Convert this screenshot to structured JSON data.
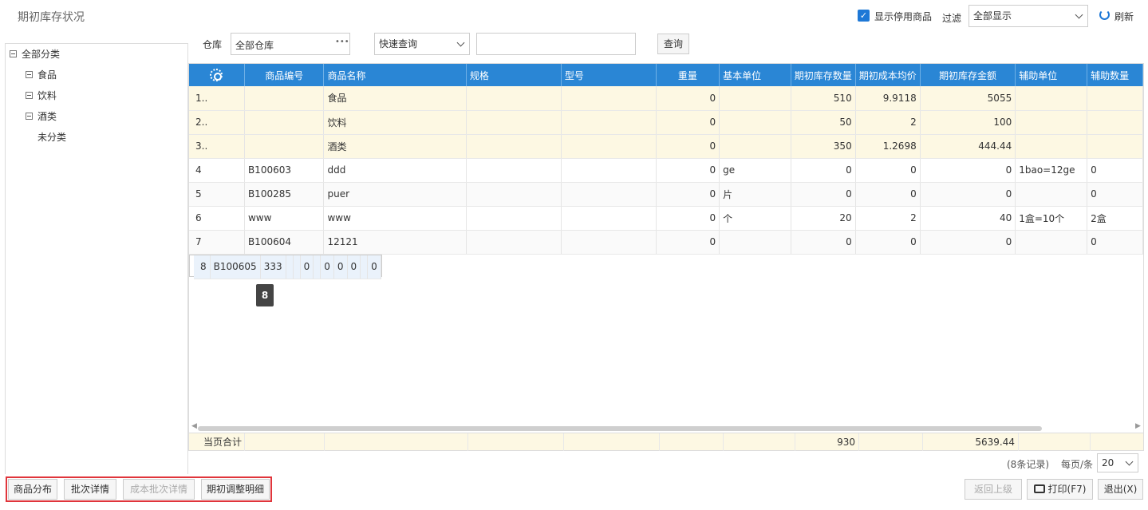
{
  "page_title": "期初库存状况",
  "top_bar": {
    "show_disabled_label": "显示停用商品",
    "show_disabled_checked": true,
    "filter_label": "过滤",
    "filter_value": "全部显示",
    "refresh_label": "刷新"
  },
  "filter_bar": {
    "warehouse_label": "仓库",
    "warehouse_value": "全部仓库",
    "ellipsis": "•••",
    "quick_query_value": "快速查询",
    "search_value": "",
    "query_button": "查询"
  },
  "tree": {
    "root": "全部分类",
    "items": [
      "食品",
      "饮料",
      "酒类",
      "未分类"
    ]
  },
  "table": {
    "columns": [
      "商品编号",
      "商品名称",
      "规格",
      "型号",
      "重量",
      "基本单位",
      "期初库存数量",
      "期初成本均价",
      "期初库存金额",
      "辅助单位",
      "辅助数量"
    ],
    "rows": [
      {
        "no": "1..",
        "code": "",
        "name": "食品",
        "spec": "",
        "model": "",
        "weight": "0",
        "unit": "",
        "qty": "510",
        "price": "9.9118",
        "amount": "5055",
        "aux_unit": "",
        "aux_qty": ""
      },
      {
        "no": "2..",
        "code": "",
        "name": "饮料",
        "spec": "",
        "model": "",
        "weight": "0",
        "unit": "",
        "qty": "50",
        "price": "2",
        "amount": "100",
        "aux_unit": "",
        "aux_qty": ""
      },
      {
        "no": "3..",
        "code": "",
        "name": "酒类",
        "spec": "",
        "model": "",
        "weight": "0",
        "unit": "",
        "qty": "350",
        "price": "1.2698",
        "amount": "444.44",
        "aux_unit": "",
        "aux_qty": ""
      },
      {
        "no": "4",
        "code": "B100603",
        "name": "ddd",
        "spec": "",
        "model": "",
        "weight": "0",
        "unit": "ge",
        "qty": "0",
        "price": "0",
        "amount": "0",
        "aux_unit": "1bao=12ge",
        "aux_qty": "0"
      },
      {
        "no": "5",
        "code": "B100285",
        "name": "puer",
        "spec": "",
        "model": "",
        "weight": "0",
        "unit": "片",
        "qty": "0",
        "price": "0",
        "amount": "0",
        "aux_unit": "",
        "aux_qty": "0"
      },
      {
        "no": "6",
        "code": "www",
        "name": "www",
        "spec": "",
        "model": "",
        "weight": "0",
        "unit": "个",
        "qty": "20",
        "price": "2",
        "amount": "40",
        "aux_unit": "1盒=10个",
        "aux_qty": "2盒"
      },
      {
        "no": "7",
        "code": "B100604",
        "name": "12121",
        "spec": "",
        "model": "",
        "weight": "0",
        "unit": "",
        "qty": "0",
        "price": "0",
        "amount": "0",
        "aux_unit": "",
        "aux_qty": "0"
      },
      {
        "no": "8",
        "code": "B100605",
        "name": "333",
        "spec": "",
        "model": "",
        "weight": "0",
        "unit": "",
        "qty": "0",
        "price": "0",
        "amount": "0",
        "aux_unit": "",
        "aux_qty": "0"
      }
    ],
    "tooltip": "8",
    "summary_label": "当页合计",
    "summary_qty": "930",
    "summary_amount": "5639.44"
  },
  "pager": {
    "records": "(8条记录)",
    "per_page_label": "每页/条",
    "per_page_value": "20"
  },
  "bottom_left_buttons": [
    "商品分布",
    "批次详情",
    "成本批次详情",
    "期初调整明细"
  ],
  "bottom_right_buttons": {
    "back": "返回上级",
    "print": "打印(F7)",
    "exit": "退出(X)"
  }
}
